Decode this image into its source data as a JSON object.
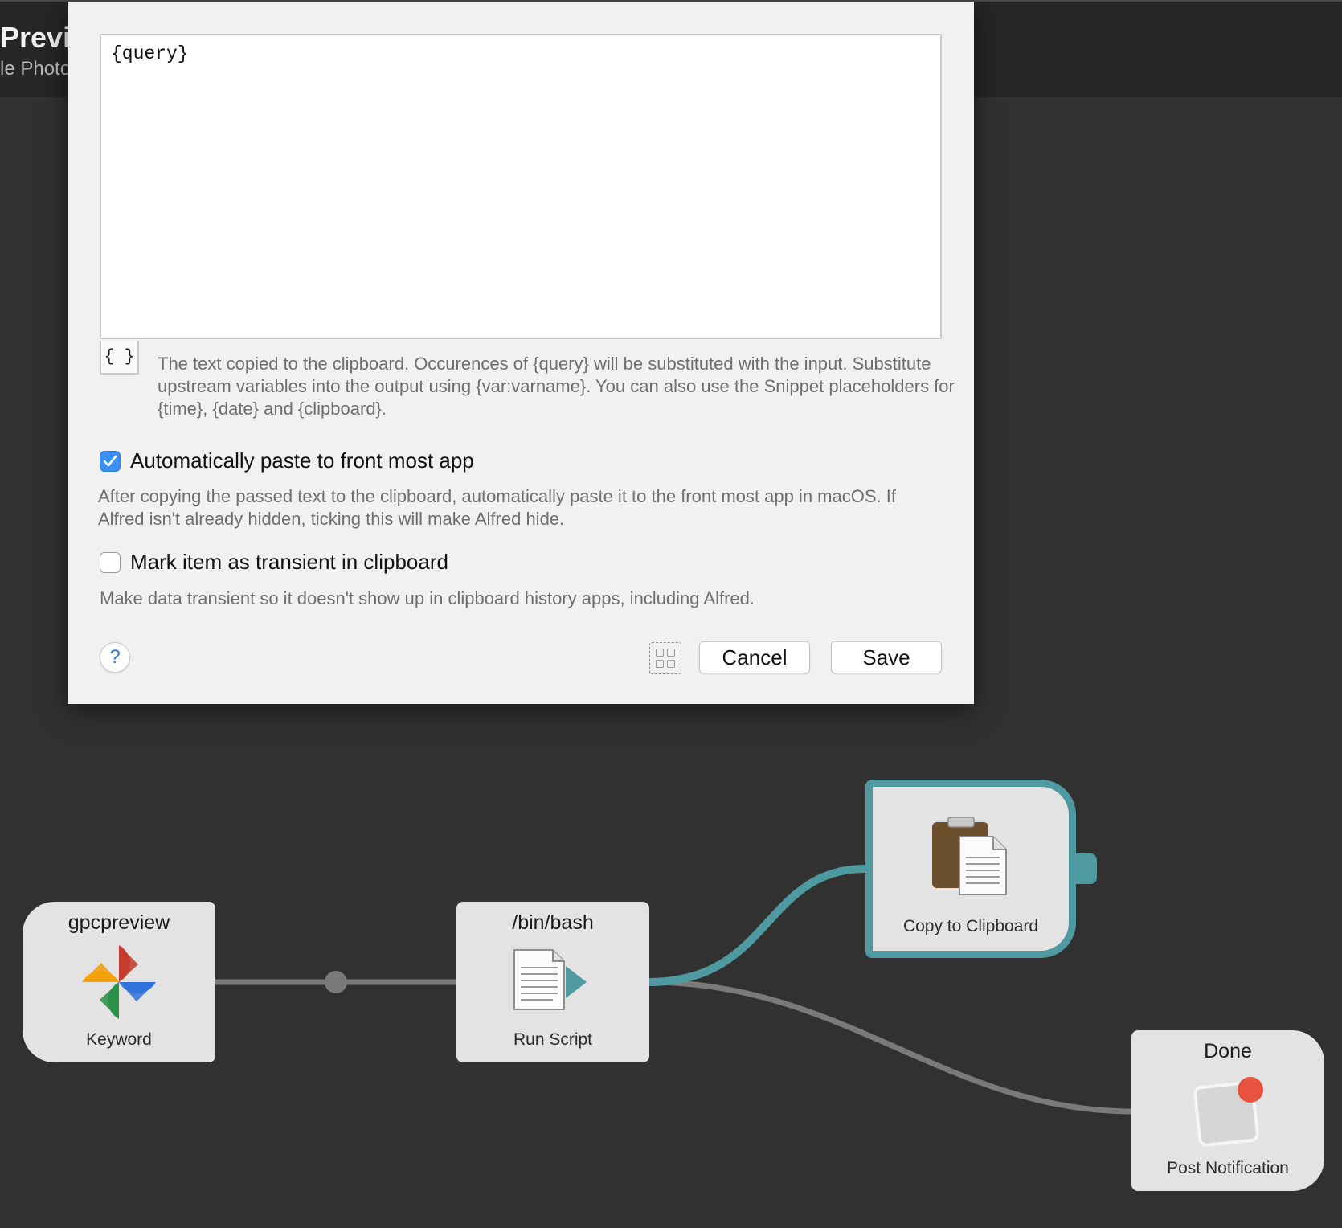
{
  "header": {
    "title_fragment": "Previ",
    "subtitle_fragment": "le Photo"
  },
  "dialog": {
    "output_text": "{query}",
    "placeholder_button": "{ }",
    "output_help": "The text copied to the clipboard. Occurences of {query} will be substituted with the input. Substitute upstream variables into the output using {var:varname}. You can also use the Snippet placeholders for {time}, {date} and {clipboard}.",
    "auto_paste": {
      "label": "Automatically paste to front most app",
      "checked": true,
      "help": "After copying the passed text to the clipboard, automatically paste it to the front most app in macOS. If Alfred isn't already hidden, ticking this will make Alfred hide."
    },
    "transient": {
      "label": "Mark item as transient in clipboard",
      "checked": false,
      "help": "Make data transient so it doesn't show up in clipboard history apps, including Alfred."
    },
    "help_symbol": "?",
    "cancel_label": "Cancel",
    "save_label": "Save"
  },
  "workflow": {
    "nodes": [
      {
        "id": "keyword",
        "title": "gpcpreview",
        "label": "Keyword",
        "icon": "google-photos-pinwheel-icon"
      },
      {
        "id": "script",
        "title": "/bin/bash",
        "label": "Run Script",
        "icon": "script-document-icon"
      },
      {
        "id": "clipboard",
        "title": "",
        "label": "Copy to Clipboard",
        "icon": "clipboard-icon",
        "selected": true
      },
      {
        "id": "notify",
        "title": "Done",
        "label": "Post Notification",
        "icon": "notification-icon"
      }
    ],
    "colors": {
      "canvas": "#313131",
      "selected": "#4e9aa0",
      "connection": "#7a7a7a",
      "checkbox_accent": "#3b8ff0"
    }
  }
}
